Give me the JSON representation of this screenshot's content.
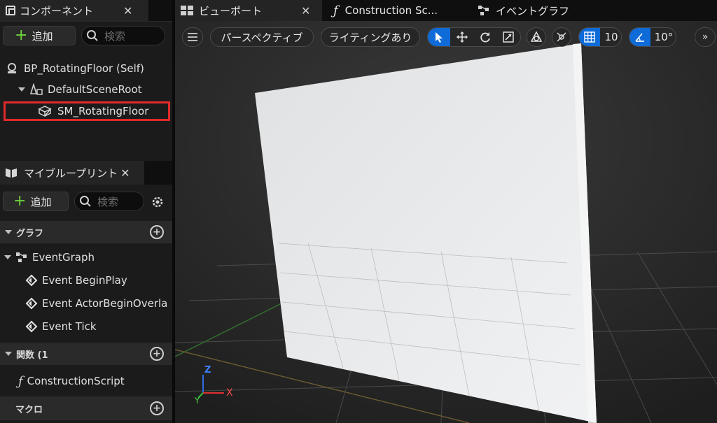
{
  "components_panel": {
    "tab_label": "コンポーネント",
    "add_label": "追加",
    "search_placeholder": "検索",
    "tree": [
      {
        "label": "BP_RotatingFloor (Self)"
      },
      {
        "label": "DefaultSceneRoot"
      },
      {
        "label": "SM_RotatingFloor"
      }
    ]
  },
  "blueprint_panel": {
    "tab_label": "マイブループリント",
    "add_label": "追加",
    "search_placeholder": "検索",
    "sections": {
      "graph": "グラフ",
      "functions": "関数 (1",
      "macros": "マクロ"
    },
    "event_graph": "EventGraph",
    "events": [
      "Event BeginPlay",
      "Event ActorBeginOverla",
      "Event Tick"
    ],
    "function": "ConstructionScript"
  },
  "editor_tabs": [
    {
      "label": "ビューポート"
    },
    {
      "label": "Construction Sc..."
    },
    {
      "label": "イベントグラフ"
    }
  ],
  "viewport_toolbar": {
    "perspective": "パースペクティブ",
    "lighting": "ライティングあり",
    "grid_snap": "10",
    "rotation_snap": "10°"
  },
  "gizmo": {
    "z": "Z",
    "x": "X",
    "y": "Y"
  },
  "colors": {
    "accent_blue": "#0e6bd8",
    "selection_red": "#e02a2a",
    "add_green": "#6fd33a"
  }
}
